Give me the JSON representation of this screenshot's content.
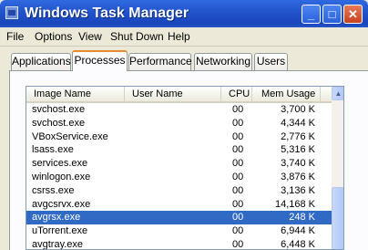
{
  "window": {
    "title": "Windows Task Manager",
    "controls": {
      "minimize": "_",
      "maximize": "□",
      "close": "✕"
    }
  },
  "menu": [
    "File",
    "Options",
    "View",
    "Shut Down",
    "Help"
  ],
  "tabs": [
    {
      "label": "Applications",
      "active": false
    },
    {
      "label": "Processes",
      "active": true
    },
    {
      "label": "Performance",
      "active": false
    },
    {
      "label": "Networking",
      "active": false
    },
    {
      "label": "Users",
      "active": false
    }
  ],
  "table": {
    "columns": [
      "Image Name",
      "User Name",
      "CPU",
      "Mem Usage"
    ],
    "rows": [
      {
        "name": "svchost.exe",
        "cpu": "00",
        "mem": "3,700 K",
        "selected": false
      },
      {
        "name": "svchost.exe",
        "cpu": "00",
        "mem": "4,344 K",
        "selected": false
      },
      {
        "name": "VBoxService.exe",
        "cpu": "00",
        "mem": "2,776 K",
        "selected": false
      },
      {
        "name": "lsass.exe",
        "cpu": "00",
        "mem": "5,316 K",
        "selected": false
      },
      {
        "name": "services.exe",
        "cpu": "00",
        "mem": "3,740 K",
        "selected": false
      },
      {
        "name": "winlogon.exe",
        "cpu": "00",
        "mem": "3,876 K",
        "selected": false
      },
      {
        "name": "csrss.exe",
        "cpu": "00",
        "mem": "3,136 K",
        "selected": false
      },
      {
        "name": "avgcsrvx.exe",
        "cpu": "00",
        "mem": "14,168 K",
        "selected": false
      },
      {
        "name": "avgrsx.exe",
        "cpu": "00",
        "mem": "248 K",
        "selected": true
      },
      {
        "name": "uTorrent.exe",
        "cpu": "00",
        "mem": "6,944 K",
        "selected": false
      },
      {
        "name": "avgtray.exe",
        "cpu": "00",
        "mem": "6,448 K",
        "selected": false
      }
    ]
  },
  "colors": {
    "titlebar": "#2a5fd6",
    "selection": "#316ac5",
    "active_tab_accent": "#e68b2c",
    "close_button": "#c8421f"
  }
}
